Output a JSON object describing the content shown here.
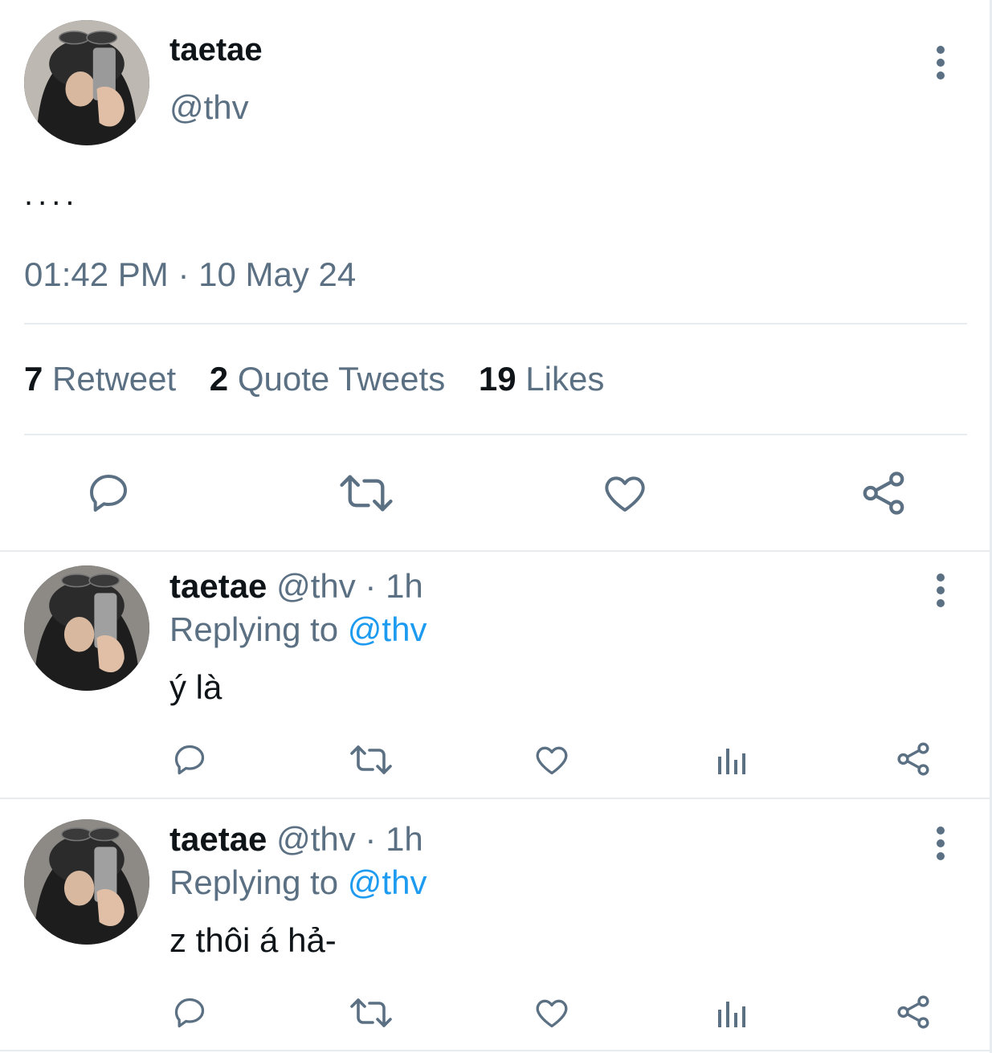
{
  "main_tweet": {
    "display_name": "taetae",
    "handle": "@thv",
    "text": "....",
    "timestamp": "01:42 PM · 10 May 24",
    "stats": {
      "retweet_count": "7",
      "retweet_label": "Retweet",
      "quote_count": "2",
      "quote_label": "Quote Tweets",
      "like_count": "19",
      "like_label": "Likes"
    }
  },
  "replies": [
    {
      "display_name": "taetae",
      "meta": "@thv · 1h",
      "replying_prefix": "Replying to",
      "replying_handle": "@thv",
      "text": "ý là"
    },
    {
      "display_name": "taetae",
      "meta": "@thv · 1h",
      "replying_prefix": "Replying to",
      "replying_handle": "@thv",
      "text": "z thôi á hả-"
    }
  ],
  "icons": {
    "reply": "speech-bubble-icon",
    "retweet": "retweet-icon",
    "like": "heart-icon",
    "share": "share-icon",
    "analytics": "bar-chart-icon",
    "more": "vertical-dots-icon"
  },
  "colors": {
    "text": "#0f1419",
    "secondary": "#5b7083",
    "link": "#1d9bf0",
    "divider": "#e6ecf0"
  }
}
